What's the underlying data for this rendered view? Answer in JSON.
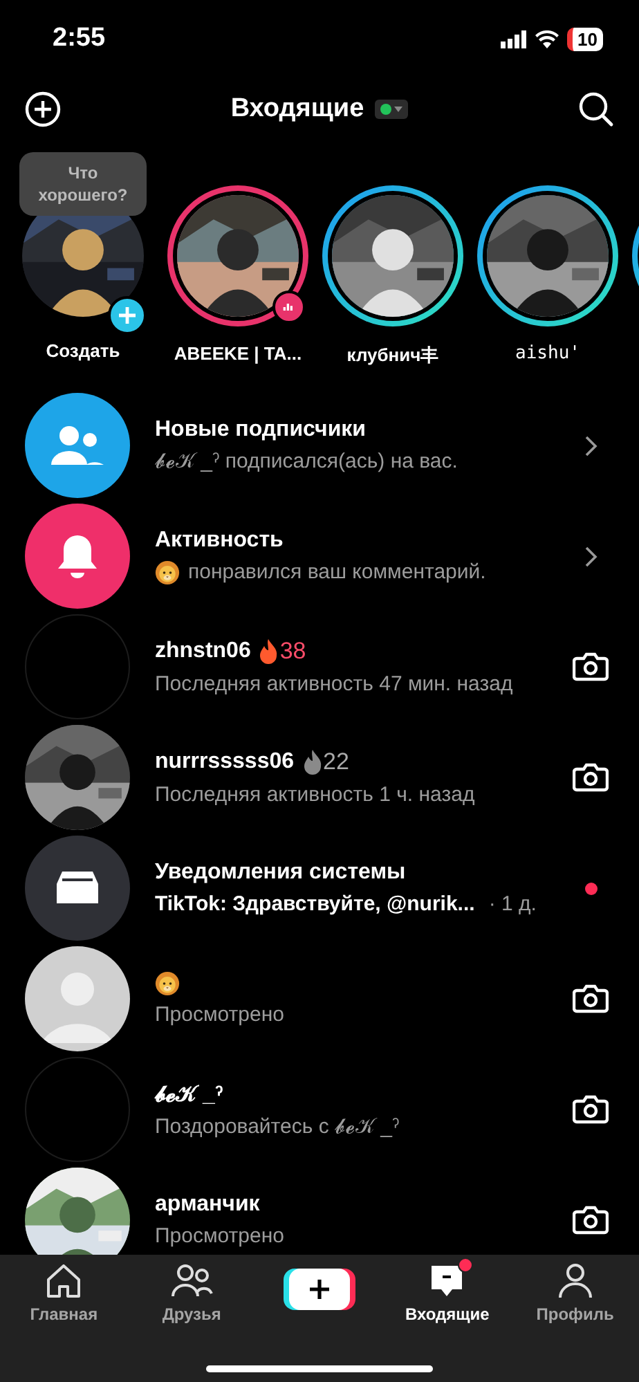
{
  "status_bar": {
    "time": "2:55",
    "battery": "10"
  },
  "header": {
    "title": "Входящие",
    "online": true
  },
  "stories": [
    {
      "kind": "create",
      "name": "Создать",
      "tooltip": "Что хорошего?"
    },
    {
      "kind": "live",
      "name": "ABEEKE | TA..."
    },
    {
      "kind": "story",
      "name": "клубнич丰"
    },
    {
      "kind": "story",
      "name": "aishu'"
    },
    {
      "kind": "story"
    }
  ],
  "rows": [
    {
      "kind": "followers",
      "title": "Новые подписчики",
      "subtitle": "𝓫𝓮𝒦 _ˀ подписался(ась) на вас.",
      "trailing": {
        "kind": "chevron"
      }
    },
    {
      "kind": "activity",
      "title": "Активность",
      "emoji_prefix": true,
      "subtitle": "понравился ваш комментарий.",
      "trailing": {
        "kind": "chevron"
      }
    },
    {
      "kind": "chat",
      "avatar": {
        "kind": "empty"
      },
      "title": "zhnstn06",
      "streak": {
        "count": "38",
        "active": true
      },
      "subtitle": "Последняя активность 47 мин. назад",
      "trailing": {
        "kind": "camera"
      }
    },
    {
      "kind": "chat",
      "title": "nurrrsssss06",
      "streak": {
        "count": "22",
        "active": false
      },
      "subtitle": "Последняя активность 1 ч. назад",
      "trailing": {
        "kind": "camera"
      }
    },
    {
      "kind": "system",
      "title": "Уведомления системы",
      "subtitle": "TikTok: Здравствуйте, @nurik...",
      "time": "· 1 д.",
      "trailing": {
        "kind": "dot"
      }
    },
    {
      "kind": "chat",
      "avatar": {
        "kind": "default"
      },
      "emoji_title": true,
      "subtitle": "Просмотрено",
      "trailing": {
        "kind": "camera"
      }
    },
    {
      "kind": "chat",
      "avatar": {
        "kind": "empty"
      },
      "title": "𝓫𝓮𝒦 _ˀ",
      "subtitle": "Поздоровайтесь с 𝓫𝓮𝒦 _ˀ",
      "trailing": {
        "kind": "camera"
      }
    },
    {
      "kind": "chat",
      "title": "арманчик",
      "subtitle": "Просмотрено",
      "trailing": {
        "kind": "camera"
      }
    }
  ],
  "nav": [
    {
      "kind": "home",
      "label": "Главная",
      "selected": false
    },
    {
      "kind": "friends",
      "label": "Друзья",
      "selected": false
    },
    {
      "kind": "create",
      "selected": false
    },
    {
      "kind": "inbox",
      "label": "Входящие",
      "selected": true,
      "badge": true
    },
    {
      "kind": "profile",
      "label": "Профиль",
      "selected": false
    }
  ]
}
